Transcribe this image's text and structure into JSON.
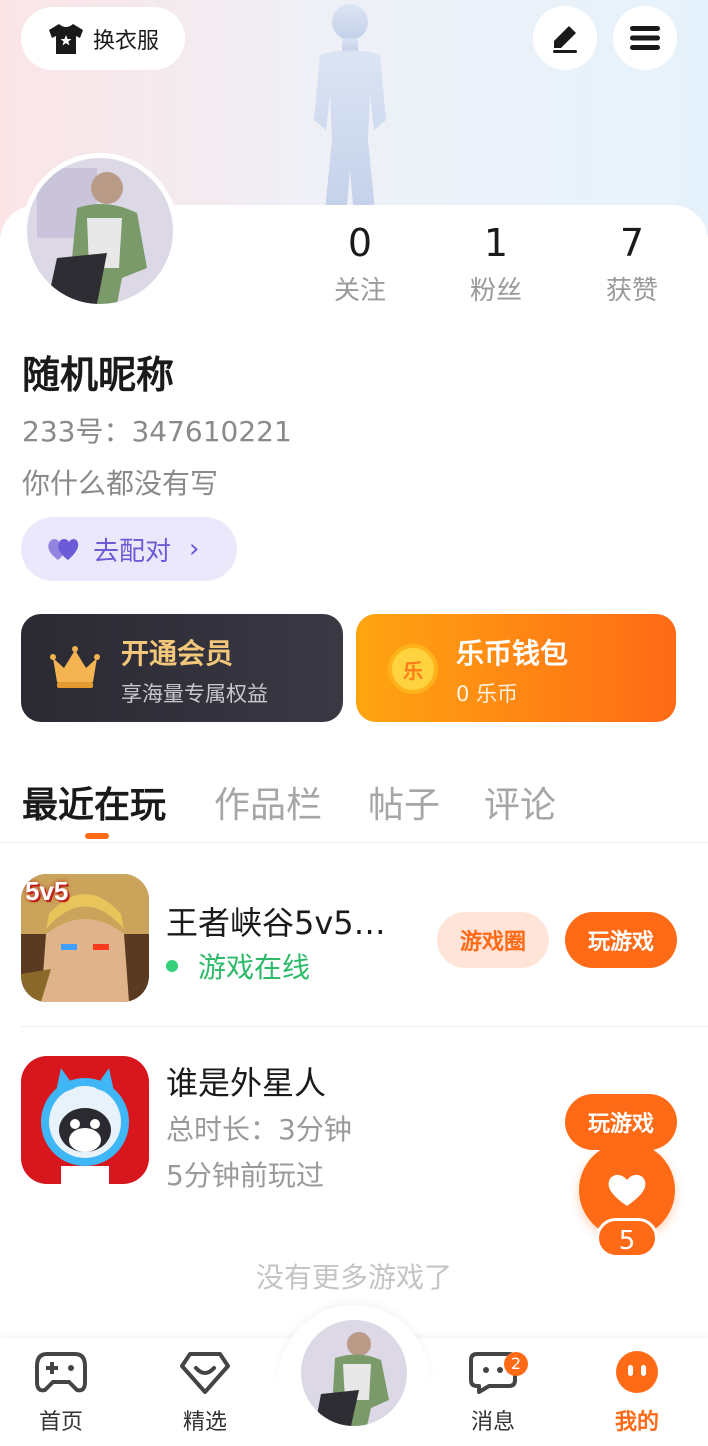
{
  "header": {
    "wardrobe_label": "换衣服",
    "icons": [
      "shirt-icon",
      "edit-icon",
      "menu-icon"
    ]
  },
  "profile": {
    "nickname": "随机昵称",
    "uid": "233号：347610221",
    "bio": "你什么都没有写",
    "stats": [
      {
        "value": "0",
        "label": "关注"
      },
      {
        "value": "1",
        "label": "粉丝"
      },
      {
        "value": "7",
        "label": "获赞"
      }
    ],
    "match_label": "去配对"
  },
  "promos": {
    "vip": {
      "title": "开通会员",
      "subtitle": "享海量专属权益"
    },
    "wallet": {
      "title": "乐币钱包",
      "subtitle": "0 乐币",
      "coin_glyph": "乐"
    }
  },
  "tabs": [
    {
      "label": "最近在玩",
      "active": true
    },
    {
      "label": "作品栏",
      "active": false
    },
    {
      "label": "帖子",
      "active": false
    },
    {
      "label": "评论",
      "active": false
    }
  ],
  "games": [
    {
      "title": "王者峡谷5v5…",
      "status": "游戏在线",
      "icon_badge": "5v5",
      "circle_button": "游戏圈",
      "play_button": "玩游戏"
    },
    {
      "title": "谁是外星人",
      "duration": "总时长：3分钟",
      "last_played": "5分钟前玩过",
      "play_button": "玩游戏"
    }
  ],
  "end_note": "没有更多游戏了",
  "like_fab": {
    "count": "5"
  },
  "bottom_nav": [
    {
      "label": "首页",
      "icon": "gamepad-icon"
    },
    {
      "label": "精选",
      "icon": "heart-shield-icon"
    },
    {
      "label": "消息",
      "icon": "chat-icon",
      "badge": "2"
    },
    {
      "label": "我的",
      "icon": "smile-icon",
      "active": true
    }
  ],
  "colors": {
    "accent": "#ff6a16",
    "match": "#6c5bd6",
    "online": "#2dbb6a"
  }
}
